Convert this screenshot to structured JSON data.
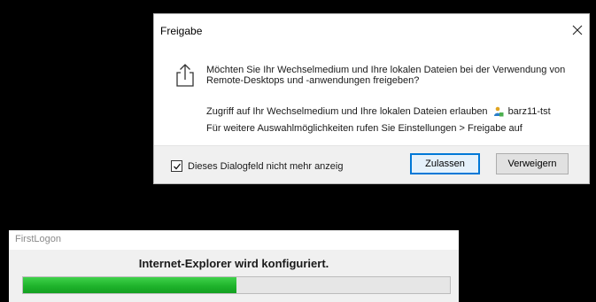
{
  "dialog": {
    "title": "Freigabe",
    "message": "Möchten Sie Ihr Wechselmedium und Ihre lokalen Dateien bei der Verwendung von Remote-Desktops und -anwendungen freigeben?",
    "access_text": "Zugriff auf Ihr Wechselmedium und Ihre lokalen Dateien erlauben",
    "device_name": "barz11-tst",
    "more_options_text": "Für weitere Auswahlmöglichkeiten rufen Sie Einstellungen > Freigabe auf",
    "checkbox_label": "Dieses Dialogfeld nicht mehr anzeig",
    "checkbox_checked": true,
    "allow_button": "Zulassen",
    "deny_button": "Verweigern",
    "icons": {
      "close": "close-icon",
      "share": "share-icon",
      "drive": "user-drive-icon"
    }
  },
  "firstlogon": {
    "title": "FirstLogon",
    "status": "Internet-Explorer wird konfiguriert.",
    "progress_fraction": 0.5
  },
  "colors": {
    "background": "#000000",
    "accent": "#0078d7",
    "progress_green": "#1fb32c"
  }
}
